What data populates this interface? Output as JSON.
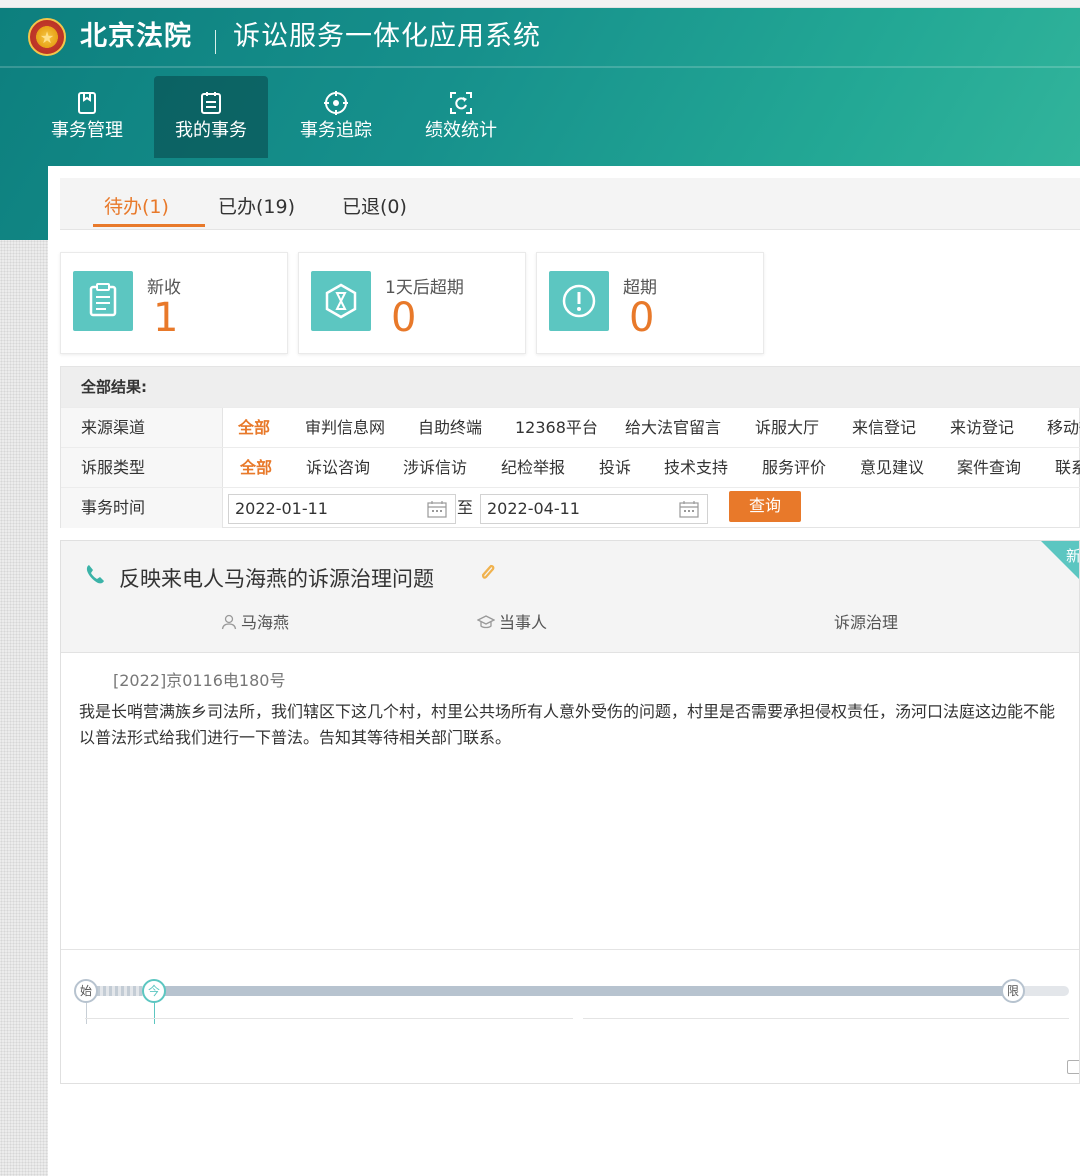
{
  "header": {
    "brand": "北京法院",
    "system_title": "诉讼服务一体化应用系统",
    "logo_icon": "court-emblem-icon"
  },
  "nav": [
    {
      "label": "事务管理",
      "icon": "file-clip-icon",
      "active": false
    },
    {
      "label": "我的事务",
      "icon": "list-doc-icon",
      "active": true
    },
    {
      "label": "事务追踪",
      "icon": "target-icon",
      "active": false
    },
    {
      "label": "绩效统计",
      "icon": "scan-refresh-icon",
      "active": false
    }
  ],
  "tabs": [
    {
      "label": "待办(1)",
      "active": true
    },
    {
      "label": "已办(19)",
      "active": false
    },
    {
      "label": "已退(0)",
      "active": false
    }
  ],
  "stats": [
    {
      "label": "新收",
      "value": "1",
      "icon": "document-icon"
    },
    {
      "label": "1天后超期",
      "value": "0",
      "icon": "hourglass-icon"
    },
    {
      "label": "超期",
      "value": "0",
      "icon": "exclamation-icon"
    }
  ],
  "filter": {
    "header": "全部结果:",
    "source_label": "来源渠道",
    "source_options": [
      "全部",
      "审判信息网",
      "自助终端",
      "12368平台",
      "给大法官留言",
      "诉服大厅",
      "来信登记",
      "来访登记",
      "移动微"
    ],
    "type_label": "诉服类型",
    "type_options": [
      "全部",
      "诉讼咨询",
      "涉诉信访",
      "纪检举报",
      "投诉",
      "技术支持",
      "服务评价",
      "意见建议",
      "案件查询",
      "联系"
    ],
    "time_label": "事务时间",
    "date_from": "2022-01-11",
    "date_sep": "至",
    "date_to": "2022-04-11",
    "query_label": "查询"
  },
  "item": {
    "title": "反映来电人马海燕的诉源治理问题",
    "badge": "新",
    "person": "马海燕",
    "role": "当事人",
    "category": "诉源治理",
    "case_no": "[2022]京0116电180号",
    "content": "我是长哨营满族乡司法所，我们辖区下这几个村，村里公共场所有人意外受伤的问题，村里是否需要承担侵权责任，汤河口法庭这边能不能以普法形式给我们进行一下普法。告知其等待相关部门联系。",
    "timeline": {
      "start": "始",
      "now": "今",
      "limit": "限"
    }
  }
}
